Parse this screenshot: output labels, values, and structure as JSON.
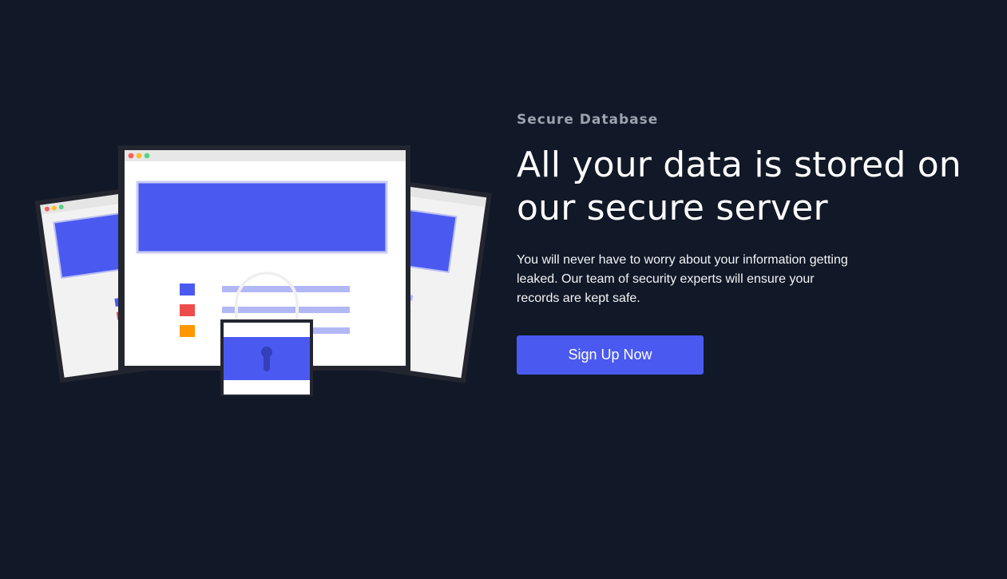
{
  "hero": {
    "eyebrow": "Secure Database",
    "headline_line1": "All your data is stored on",
    "headline_line2": "our secure server",
    "body": "You will never have to worry about your information getting leaked. Our team of security experts will ensure your records are kept safe.",
    "cta_label": "Sign Up Now"
  },
  "colors": {
    "background": "#111827",
    "accent": "#4a5af0",
    "eyebrow": "#9ca3af",
    "heading": "#ffffff"
  },
  "illustration": {
    "icon": "secure-database-lock-illustration"
  }
}
